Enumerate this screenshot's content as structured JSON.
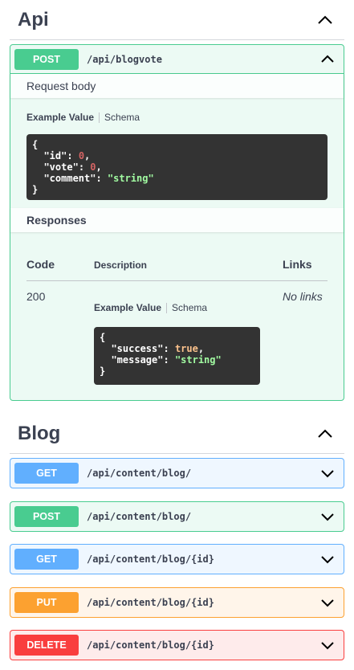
{
  "sections": [
    {
      "title": "Api"
    },
    {
      "title": "Blog"
    }
  ],
  "api_op": {
    "method": "POST",
    "path": "/api/blogvote",
    "request_body_label": "Request body",
    "tab_example": "Example Value",
    "tab_schema": "Schema",
    "example": [
      {
        "key": "\"id\"",
        "value": "0",
        "kind": "n",
        "comma": ","
      },
      {
        "key": "\"vote\"",
        "value": "0",
        "kind": "n",
        "comma": ","
      },
      {
        "key": "\"comment\"",
        "value": "\"string\"",
        "kind": "s",
        "comma": ""
      }
    ],
    "responses_label": "Responses",
    "col_code": "Code",
    "col_description": "Description",
    "col_links": "Links",
    "response": {
      "code": "200",
      "no_links": "No links",
      "tab_example": "Example Value",
      "tab_schema": "Schema",
      "example": [
        {
          "key": "\"success\"",
          "value": "true",
          "kind": "b",
          "comma": ","
        },
        {
          "key": "\"message\"",
          "value": "\"string\"",
          "kind": "s",
          "comma": ""
        }
      ]
    }
  },
  "blog_ops": [
    {
      "method": "GET",
      "path": "/api/content/blog/",
      "style": "get"
    },
    {
      "method": "POST",
      "path": "/api/content/blog/",
      "style": "post"
    },
    {
      "method": "GET",
      "path": "/api/content/blog/{id}",
      "style": "get"
    },
    {
      "method": "PUT",
      "path": "/api/content/blog/{id}",
      "style": "put"
    },
    {
      "method": "DELETE",
      "path": "/api/content/blog/{id}",
      "style": "delete"
    }
  ],
  "icons": {
    "collapse": "chevron-up-icon",
    "expand": "chevron-down-icon"
  },
  "colors": {
    "post": "#49cc90",
    "get": "#61affe",
    "put": "#fca130",
    "delete": "#f93e3e",
    "code_bg": "#333333"
  }
}
